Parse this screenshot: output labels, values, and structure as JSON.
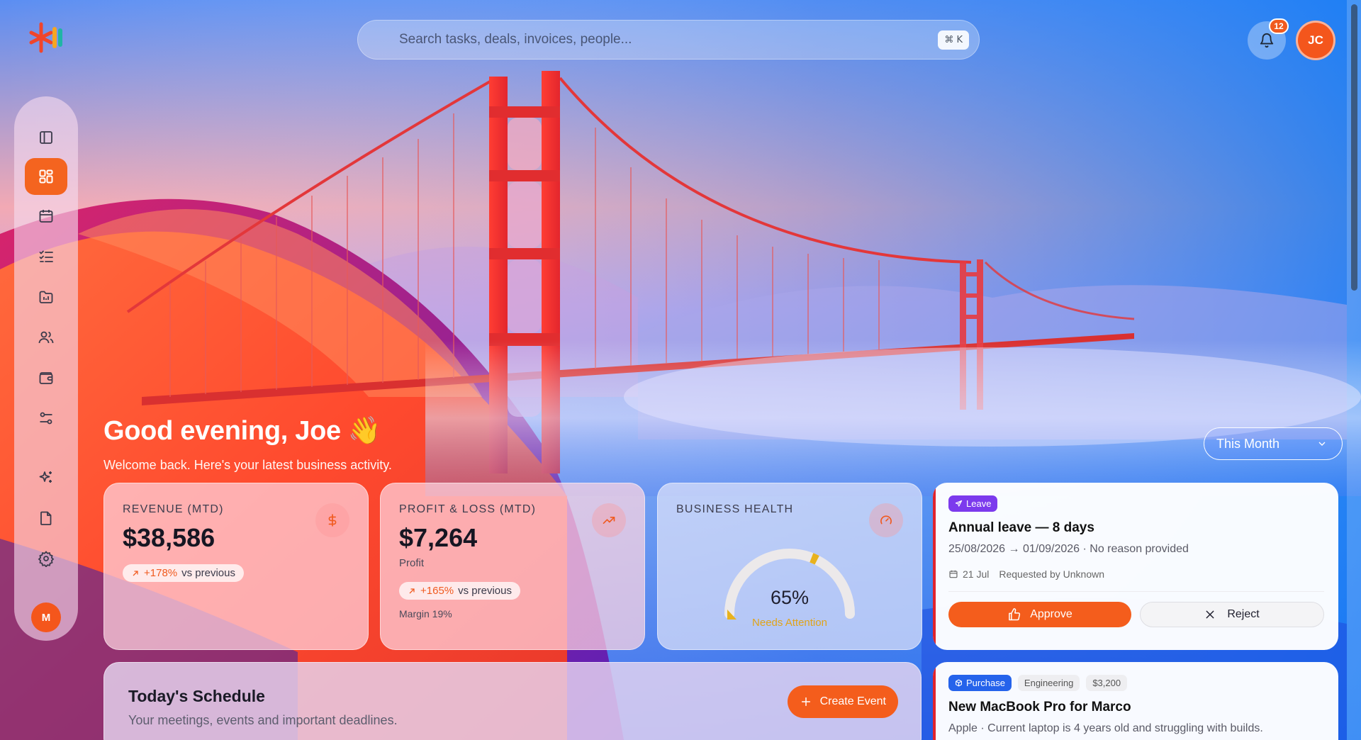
{
  "search": {
    "placeholder": "Search tasks, deals, invoices, people...",
    "shortcut": "⌘ K"
  },
  "notifications": {
    "count": "12"
  },
  "user": {
    "initials": "JC"
  },
  "sidebar": {
    "items": [
      {
        "name": "toggle-sidebar",
        "icon": "sidebar-toggle-icon",
        "active": false
      },
      {
        "name": "dashboard",
        "icon": "dashboard-grid-icon",
        "active": true
      },
      {
        "name": "calendar",
        "icon": "calendar-icon",
        "active": false
      },
      {
        "name": "tasks",
        "icon": "checklist-icon",
        "active": false
      },
      {
        "name": "projects",
        "icon": "folder-chart-icon",
        "active": false
      },
      {
        "name": "people",
        "icon": "users-icon",
        "active": false
      },
      {
        "name": "wallet",
        "icon": "wallet-icon",
        "active": false
      },
      {
        "name": "workflows",
        "icon": "sliders-icon",
        "active": false
      },
      {
        "name": "ai",
        "icon": "sparkles-icon",
        "active": false
      },
      {
        "name": "documents",
        "icon": "file-icon",
        "active": false
      },
      {
        "name": "settings",
        "icon": "gear-icon",
        "active": false
      }
    ],
    "workspace_initial": "M"
  },
  "greeting": {
    "title": "Good evening, Joe",
    "emoji": "👋",
    "subtitle": "Welcome back. Here's your latest business activity."
  },
  "period": {
    "selected": "This Month"
  },
  "kpis": {
    "revenue": {
      "label": "REVENUE (MTD)",
      "value": "$38,586",
      "trend_pct": "+178%",
      "trend_text": "vs previous"
    },
    "profit": {
      "label": "PROFIT & LOSS (MTD)",
      "value": "$7,264",
      "sub": "Profit",
      "trend_pct": "+165%",
      "trend_text": "vs previous",
      "margin": "Margin 19%"
    },
    "health": {
      "label": "BUSINESS HEALTH",
      "value": "65%",
      "level": 0.65,
      "state": "Needs Attention"
    }
  },
  "approvals": [
    {
      "tag": "Leave",
      "title": "Annual leave — 8 days",
      "detail": "25/08/2026 → 01/09/2026 · No reason provided",
      "date": "21 Jul",
      "requested_by": "Requested by Unknown",
      "approve_label": "Approve",
      "reject_label": "Reject"
    },
    {
      "tag": "Purchase",
      "department": "Engineering",
      "amount": "$3,200",
      "title": "New MacBook Pro for Marco",
      "detail": "Apple · Current laptop is 4 years old and struggling with builds."
    }
  ],
  "schedule": {
    "title": "Today's Schedule",
    "subtitle": "Your meetings, events and important deadlines.",
    "create_label": "Create Event"
  },
  "colors": {
    "accent": "#f45d1c",
    "leave_tag": "#7c3aed",
    "purchase_tag": "#2563eb",
    "warning": "#e0a419"
  }
}
